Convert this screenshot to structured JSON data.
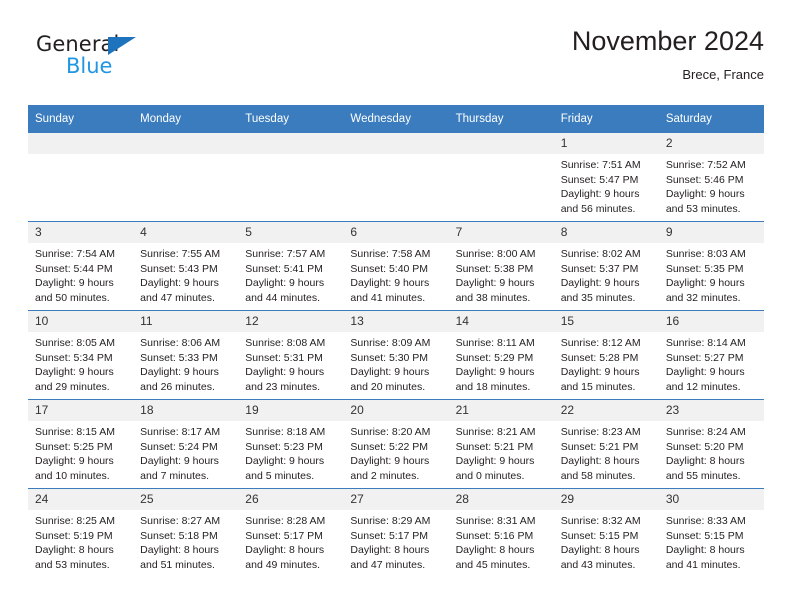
{
  "logo": {
    "word_one": "General",
    "word_two": "Blue",
    "triangle_color": "#1d74bd",
    "blue_text_color": "#2196e3"
  },
  "header": {
    "title": "November 2024",
    "location": "Brece, France"
  },
  "theme": {
    "header_blue": "#3a7cbe",
    "daynum_gray": "#f1f1f1",
    "text": "#231f20"
  },
  "weekdays": [
    "Sunday",
    "Monday",
    "Tuesday",
    "Wednesday",
    "Thursday",
    "Friday",
    "Saturday"
  ],
  "weeks": [
    [
      {
        "day": "",
        "sunrise": "",
        "sunset": "",
        "daylight1": "",
        "daylight2": ""
      },
      {
        "day": "",
        "sunrise": "",
        "sunset": "",
        "daylight1": "",
        "daylight2": ""
      },
      {
        "day": "",
        "sunrise": "",
        "sunset": "",
        "daylight1": "",
        "daylight2": ""
      },
      {
        "day": "",
        "sunrise": "",
        "sunset": "",
        "daylight1": "",
        "daylight2": ""
      },
      {
        "day": "",
        "sunrise": "",
        "sunset": "",
        "daylight1": "",
        "daylight2": ""
      },
      {
        "day": "1",
        "sunrise": "Sunrise: 7:51 AM",
        "sunset": "Sunset: 5:47 PM",
        "daylight1": "Daylight: 9 hours",
        "daylight2": "and 56 minutes."
      },
      {
        "day": "2",
        "sunrise": "Sunrise: 7:52 AM",
        "sunset": "Sunset: 5:46 PM",
        "daylight1": "Daylight: 9 hours",
        "daylight2": "and 53 minutes."
      }
    ],
    [
      {
        "day": "3",
        "sunrise": "Sunrise: 7:54 AM",
        "sunset": "Sunset: 5:44 PM",
        "daylight1": "Daylight: 9 hours",
        "daylight2": "and 50 minutes."
      },
      {
        "day": "4",
        "sunrise": "Sunrise: 7:55 AM",
        "sunset": "Sunset: 5:43 PM",
        "daylight1": "Daylight: 9 hours",
        "daylight2": "and 47 minutes."
      },
      {
        "day": "5",
        "sunrise": "Sunrise: 7:57 AM",
        "sunset": "Sunset: 5:41 PM",
        "daylight1": "Daylight: 9 hours",
        "daylight2": "and 44 minutes."
      },
      {
        "day": "6",
        "sunrise": "Sunrise: 7:58 AM",
        "sunset": "Sunset: 5:40 PM",
        "daylight1": "Daylight: 9 hours",
        "daylight2": "and 41 minutes."
      },
      {
        "day": "7",
        "sunrise": "Sunrise: 8:00 AM",
        "sunset": "Sunset: 5:38 PM",
        "daylight1": "Daylight: 9 hours",
        "daylight2": "and 38 minutes."
      },
      {
        "day": "8",
        "sunrise": "Sunrise: 8:02 AM",
        "sunset": "Sunset: 5:37 PM",
        "daylight1": "Daylight: 9 hours",
        "daylight2": "and 35 minutes."
      },
      {
        "day": "9",
        "sunrise": "Sunrise: 8:03 AM",
        "sunset": "Sunset: 5:35 PM",
        "daylight1": "Daylight: 9 hours",
        "daylight2": "and 32 minutes."
      }
    ],
    [
      {
        "day": "10",
        "sunrise": "Sunrise: 8:05 AM",
        "sunset": "Sunset: 5:34 PM",
        "daylight1": "Daylight: 9 hours",
        "daylight2": "and 29 minutes."
      },
      {
        "day": "11",
        "sunrise": "Sunrise: 8:06 AM",
        "sunset": "Sunset: 5:33 PM",
        "daylight1": "Daylight: 9 hours",
        "daylight2": "and 26 minutes."
      },
      {
        "day": "12",
        "sunrise": "Sunrise: 8:08 AM",
        "sunset": "Sunset: 5:31 PM",
        "daylight1": "Daylight: 9 hours",
        "daylight2": "and 23 minutes."
      },
      {
        "day": "13",
        "sunrise": "Sunrise: 8:09 AM",
        "sunset": "Sunset: 5:30 PM",
        "daylight1": "Daylight: 9 hours",
        "daylight2": "and 20 minutes."
      },
      {
        "day": "14",
        "sunrise": "Sunrise: 8:11 AM",
        "sunset": "Sunset: 5:29 PM",
        "daylight1": "Daylight: 9 hours",
        "daylight2": "and 18 minutes."
      },
      {
        "day": "15",
        "sunrise": "Sunrise: 8:12 AM",
        "sunset": "Sunset: 5:28 PM",
        "daylight1": "Daylight: 9 hours",
        "daylight2": "and 15 minutes."
      },
      {
        "day": "16",
        "sunrise": "Sunrise: 8:14 AM",
        "sunset": "Sunset: 5:27 PM",
        "daylight1": "Daylight: 9 hours",
        "daylight2": "and 12 minutes."
      }
    ],
    [
      {
        "day": "17",
        "sunrise": "Sunrise: 8:15 AM",
        "sunset": "Sunset: 5:25 PM",
        "daylight1": "Daylight: 9 hours",
        "daylight2": "and 10 minutes."
      },
      {
        "day": "18",
        "sunrise": "Sunrise: 8:17 AM",
        "sunset": "Sunset: 5:24 PM",
        "daylight1": "Daylight: 9 hours",
        "daylight2": "and 7 minutes."
      },
      {
        "day": "19",
        "sunrise": "Sunrise: 8:18 AM",
        "sunset": "Sunset: 5:23 PM",
        "daylight1": "Daylight: 9 hours",
        "daylight2": "and 5 minutes."
      },
      {
        "day": "20",
        "sunrise": "Sunrise: 8:20 AM",
        "sunset": "Sunset: 5:22 PM",
        "daylight1": "Daylight: 9 hours",
        "daylight2": "and 2 minutes."
      },
      {
        "day": "21",
        "sunrise": "Sunrise: 8:21 AM",
        "sunset": "Sunset: 5:21 PM",
        "daylight1": "Daylight: 9 hours",
        "daylight2": "and 0 minutes."
      },
      {
        "day": "22",
        "sunrise": "Sunrise: 8:23 AM",
        "sunset": "Sunset: 5:21 PM",
        "daylight1": "Daylight: 8 hours",
        "daylight2": "and 58 minutes."
      },
      {
        "day": "23",
        "sunrise": "Sunrise: 8:24 AM",
        "sunset": "Sunset: 5:20 PM",
        "daylight1": "Daylight: 8 hours",
        "daylight2": "and 55 minutes."
      }
    ],
    [
      {
        "day": "24",
        "sunrise": "Sunrise: 8:25 AM",
        "sunset": "Sunset: 5:19 PM",
        "daylight1": "Daylight: 8 hours",
        "daylight2": "and 53 minutes."
      },
      {
        "day": "25",
        "sunrise": "Sunrise: 8:27 AM",
        "sunset": "Sunset: 5:18 PM",
        "daylight1": "Daylight: 8 hours",
        "daylight2": "and 51 minutes."
      },
      {
        "day": "26",
        "sunrise": "Sunrise: 8:28 AM",
        "sunset": "Sunset: 5:17 PM",
        "daylight1": "Daylight: 8 hours",
        "daylight2": "and 49 minutes."
      },
      {
        "day": "27",
        "sunrise": "Sunrise: 8:29 AM",
        "sunset": "Sunset: 5:17 PM",
        "daylight1": "Daylight: 8 hours",
        "daylight2": "and 47 minutes."
      },
      {
        "day": "28",
        "sunrise": "Sunrise: 8:31 AM",
        "sunset": "Sunset: 5:16 PM",
        "daylight1": "Daylight: 8 hours",
        "daylight2": "and 45 minutes."
      },
      {
        "day": "29",
        "sunrise": "Sunrise: 8:32 AM",
        "sunset": "Sunset: 5:15 PM",
        "daylight1": "Daylight: 8 hours",
        "daylight2": "and 43 minutes."
      },
      {
        "day": "30",
        "sunrise": "Sunrise: 8:33 AM",
        "sunset": "Sunset: 5:15 PM",
        "daylight1": "Daylight: 8 hours",
        "daylight2": "and 41 minutes."
      }
    ]
  ]
}
